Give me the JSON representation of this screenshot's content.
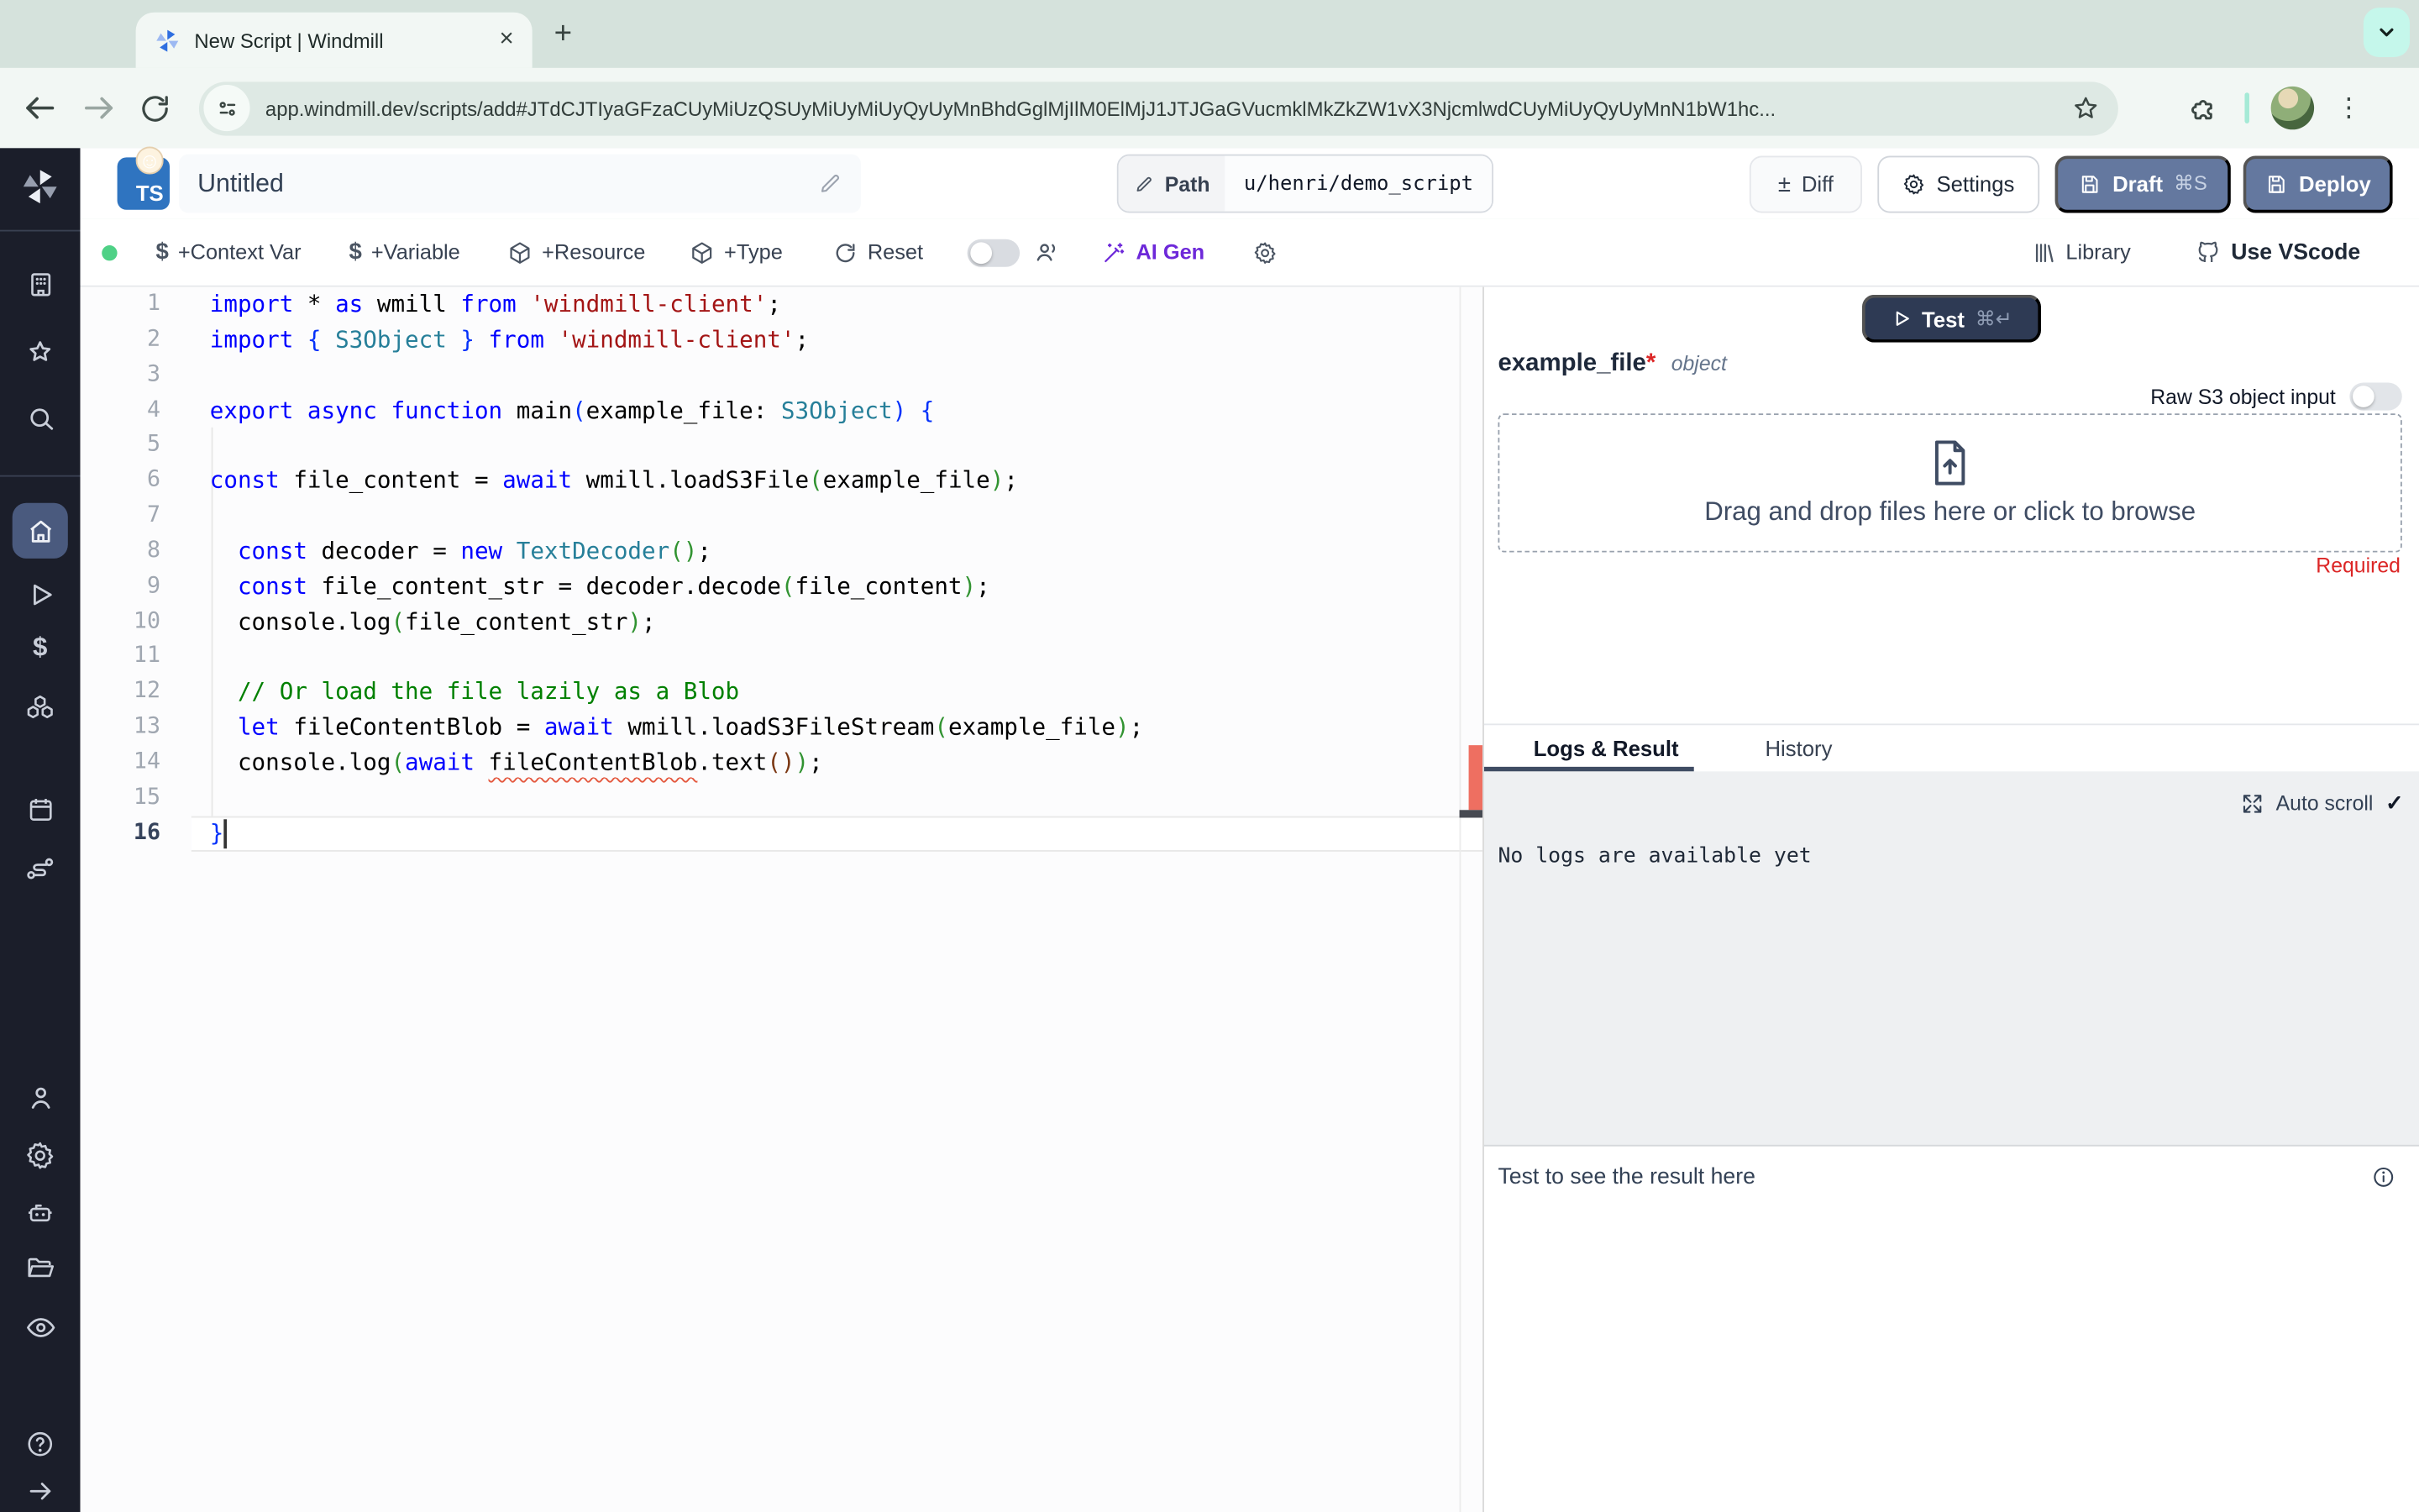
{
  "browser": {
    "tab_title": "New Script | Windmill",
    "close_tab": "×",
    "new_tab": "+",
    "url": "app.windmill.dev/scripts/add#JTdCJTIyaGFzaCUyMiUzQSUyMiUyMiUyQyUyMnBhdGglMjIlM0ElMjJ1JTJGaGVucmklMkZkZW1vX3NjcmlwdCUyMiUyQyUyMnN1bW1hc...",
    "kebab": "⋮"
  },
  "header": {
    "lang_badge": "TS",
    "badge_emoji": "☺",
    "script_title": "Untitled",
    "path_label": "Path",
    "path_value": "u/henri/demo_script",
    "plusminus": "±",
    "diff_label": "Diff",
    "settings_label": "Settings",
    "draft_label": "Draft",
    "draft_shortcut": "⌘S",
    "deploy_label": "Deploy"
  },
  "toolbar": {
    "items": [
      {
        "label": "+Context Var"
      },
      {
        "label": "+Variable"
      },
      {
        "label": "+Resource"
      },
      {
        "label": "+Type"
      },
      {
        "label": "Reset"
      },
      {
        "label": "AI Gen"
      }
    ],
    "library_label": "Library",
    "vscode_label": "Use VScode"
  },
  "editor": {
    "language": "TypeScript",
    "active_line": 16,
    "lines": [
      {
        "n": 1,
        "tokens": [
          [
            "kw",
            "import"
          ],
          [
            "tx",
            " * "
          ],
          [
            "kw",
            "as"
          ],
          [
            "tx",
            " wmill "
          ],
          [
            "kw",
            "from"
          ],
          [
            "tx",
            " "
          ],
          [
            "str",
            "'windmill-client'"
          ],
          [
            "tx",
            ";"
          ]
        ]
      },
      {
        "n": 2,
        "tokens": [
          [
            "kw",
            "import"
          ],
          [
            "tx",
            " "
          ],
          [
            "b0",
            "{"
          ],
          [
            "tx",
            " "
          ],
          [
            "ty",
            "S3Object"
          ],
          [
            "tx",
            " "
          ],
          [
            "b0",
            "}"
          ],
          [
            "tx",
            " "
          ],
          [
            "kw",
            "from"
          ],
          [
            "tx",
            " "
          ],
          [
            "str",
            "'windmill-client'"
          ],
          [
            "tx",
            ";"
          ]
        ]
      },
      {
        "n": 3,
        "tokens": []
      },
      {
        "n": 4,
        "tokens": [
          [
            "kw",
            "export"
          ],
          [
            "tx",
            " "
          ],
          [
            "kw",
            "async"
          ],
          [
            "tx",
            " "
          ],
          [
            "kw",
            "function"
          ],
          [
            "tx",
            " main"
          ],
          [
            "b0",
            "("
          ],
          [
            "tx",
            "example_file: "
          ],
          [
            "ty",
            "S3Object"
          ],
          [
            "b0",
            ")"
          ],
          [
            "tx",
            " "
          ],
          [
            "b0",
            "{"
          ]
        ]
      },
      {
        "n": 5,
        "tokens": []
      },
      {
        "n": 6,
        "tokens": [
          [
            "kw",
            "const"
          ],
          [
            "tx",
            " file_content = "
          ],
          [
            "kw",
            "await"
          ],
          [
            "tx",
            " wmill.loadS3File"
          ],
          [
            "b1",
            "("
          ],
          [
            "tx",
            "example_file"
          ],
          [
            "b1",
            ")"
          ],
          [
            "tx",
            ";"
          ]
        ]
      },
      {
        "n": 7,
        "tokens": []
      },
      {
        "n": 8,
        "tokens": [
          [
            "tx",
            "  "
          ],
          [
            "kw",
            "const"
          ],
          [
            "tx",
            " decoder = "
          ],
          [
            "kw",
            "new"
          ],
          [
            "tx",
            " "
          ],
          [
            "ty",
            "TextDecoder"
          ],
          [
            "b1",
            "()"
          ],
          [
            "tx",
            ";"
          ]
        ]
      },
      {
        "n": 9,
        "tokens": [
          [
            "tx",
            "  "
          ],
          [
            "kw",
            "const"
          ],
          [
            "tx",
            " file_content_str = decoder.decode"
          ],
          [
            "b1",
            "("
          ],
          [
            "tx",
            "file_content"
          ],
          [
            "b1",
            ")"
          ],
          [
            "tx",
            ";"
          ]
        ]
      },
      {
        "n": 10,
        "tokens": [
          [
            "tx",
            "  console.log"
          ],
          [
            "b1",
            "("
          ],
          [
            "tx",
            "file_content_str"
          ],
          [
            "b1",
            ")"
          ],
          [
            "tx",
            ";"
          ]
        ]
      },
      {
        "n": 11,
        "tokens": []
      },
      {
        "n": 12,
        "tokens": [
          [
            "tx",
            "  "
          ],
          [
            "cm",
            "// Or load the file lazily as a Blob"
          ]
        ]
      },
      {
        "n": 13,
        "tokens": [
          [
            "tx",
            "  "
          ],
          [
            "kw",
            "let"
          ],
          [
            "tx",
            " fileContentBlob = "
          ],
          [
            "kw",
            "await"
          ],
          [
            "tx",
            " wmill.loadS3FileStream"
          ],
          [
            "b1",
            "("
          ],
          [
            "tx",
            "example_file"
          ],
          [
            "b1",
            ")"
          ],
          [
            "tx",
            ";"
          ]
        ]
      },
      {
        "n": 14,
        "tokens": [
          [
            "tx",
            "  console.log"
          ],
          [
            "b1",
            "("
          ],
          [
            "kw",
            "await"
          ],
          [
            "tx",
            " "
          ],
          [
            "er",
            "fileContentBlob"
          ],
          [
            "tx",
            ".text"
          ],
          [
            "b2",
            "()"
          ],
          [
            "b1",
            ")"
          ],
          [
            "tx",
            ";"
          ]
        ]
      },
      {
        "n": 15,
        "tokens": []
      },
      {
        "n": 16,
        "tokens": [
          [
            "b0",
            "}"
          ]
        ]
      }
    ]
  },
  "panel": {
    "test_label": "Test",
    "test_shortcut": "⌘↵",
    "arg_name": "example_file",
    "required_star": "*",
    "arg_type": "object",
    "raw_s3_label": "Raw S3 object input",
    "dropzone_text": "Drag and drop files here or click to browse",
    "required_label": "Required",
    "tab_logs": "Logs & Result",
    "tab_history": "History",
    "auto_scroll_label": "Auto scroll",
    "auto_scroll_check": "✓",
    "no_logs_text": "No logs are available yet",
    "result_placeholder": "Test to see the result here"
  },
  "colors": {
    "chrome_bg": "#d5e2dc",
    "chrome_surface": "#f2f7f4",
    "omnibox_bg": "#dee9e4",
    "tab_search_bg": "#c5f7eb",
    "sidebar_bg": "#1b1e2a",
    "sidebar_active": "#4a5a7e",
    "primary_button": "#64789f",
    "test_button": "#2e3a54",
    "ai_gen": "#6d28d9",
    "live_dot": "#4fd186",
    "required_red": "#dc2626",
    "error_marker": "#ee6f61",
    "logs_bg": "#eef0f2",
    "ts_badge": "#2f74c0",
    "keyword": "#0000ff",
    "string": "#a31515",
    "type": "#267f99",
    "comment": "#008000",
    "bracket_blue": "#0431fa",
    "bracket_green": "#319331",
    "bracket_brown": "#7b3814"
  }
}
